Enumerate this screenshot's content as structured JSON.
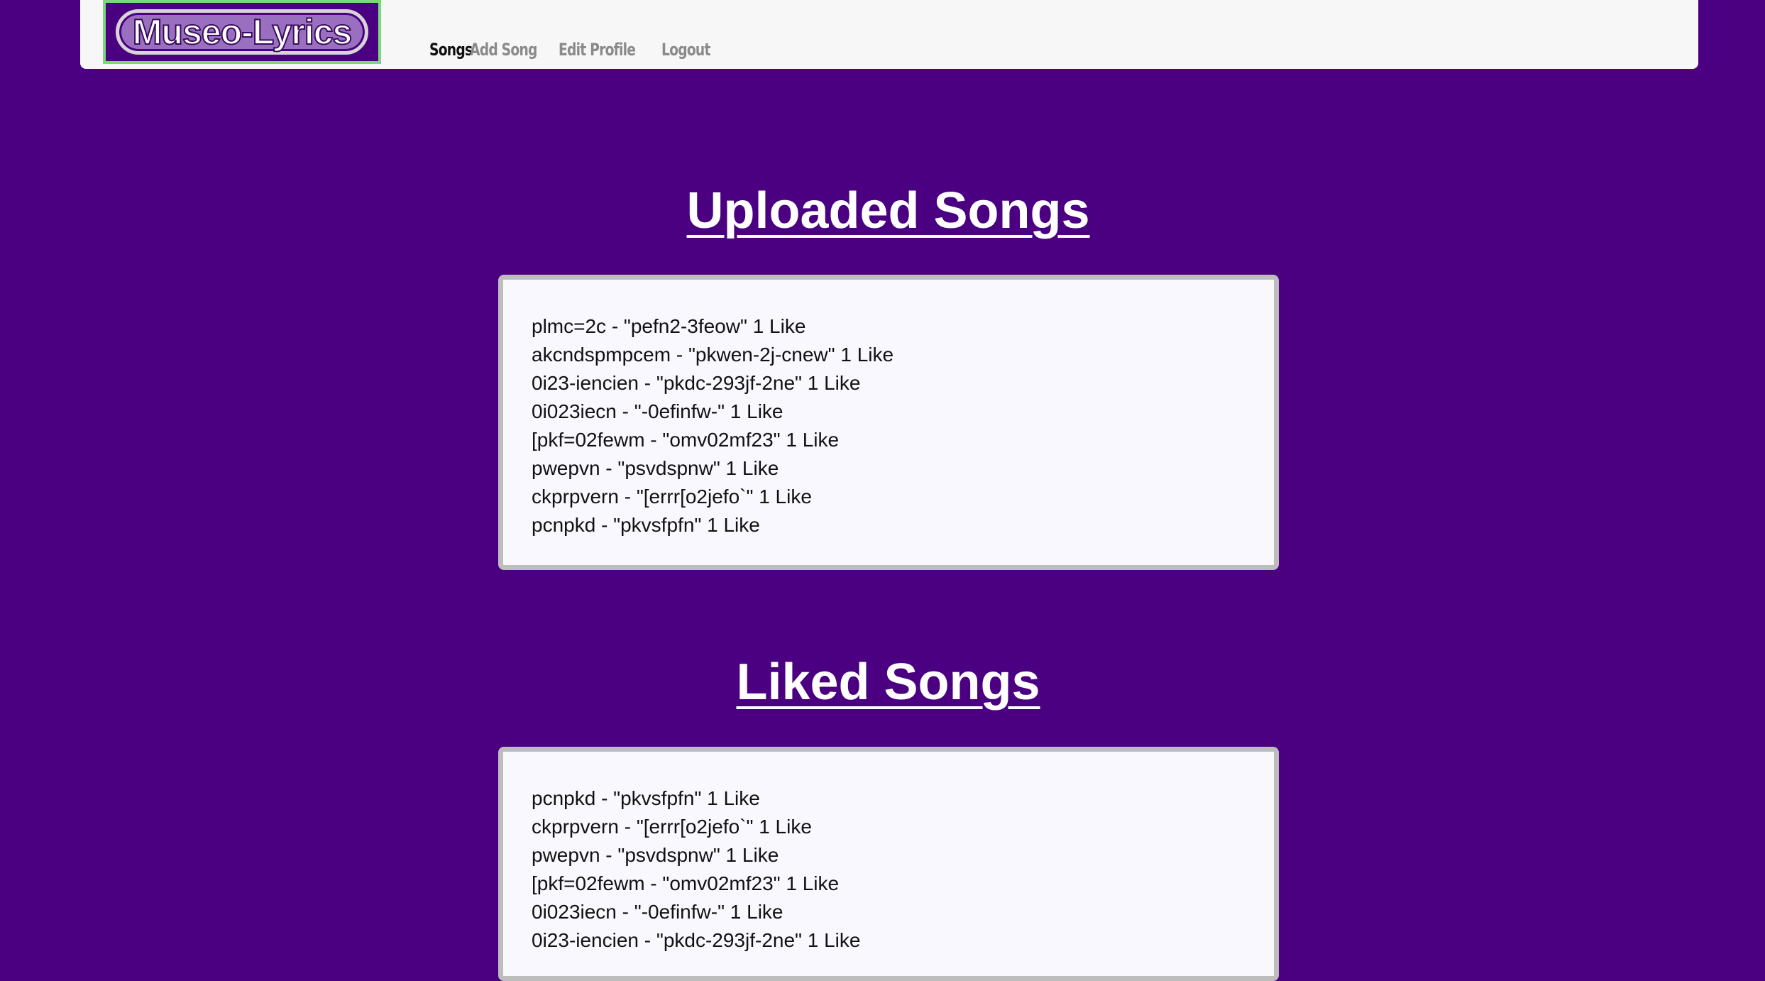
{
  "header": {
    "logo_text": "Museo-Lyrics",
    "nav": [
      {
        "label": "Songs",
        "active": true
      },
      {
        "label": "Add Song",
        "active": false
      },
      {
        "label": "Edit Profile",
        "active": false
      },
      {
        "label": "Logout",
        "active": false
      }
    ]
  },
  "uploaded": {
    "title": "Uploaded Songs",
    "songs": [
      "plmc=2c - \"pefn2-3feow\" 1 Like",
      "akcndspmpcem - \"pkwen-2j-cnew\" 1 Like",
      "0i23-iencien - \"pkdc-293jf-2ne\" 1 Like",
      "0i023iecn - \"-0efinfw-\" 1 Like",
      "[pkf=02fewm - \"omv02mf23\" 1 Like",
      "pwepvn - \"psvdspnw\" 1 Like",
      "ckprpvern - \"[errr[o2jefo`\" 1 Like",
      "pcnpkd - \"pkvsfpfn\" 1 Like"
    ]
  },
  "liked": {
    "title": "Liked Songs",
    "songs": [
      "pcnpkd - \"pkvsfpfn\" 1 Like",
      "ckprpvern - \"[errr[o2jefo`\" 1 Like",
      "pwepvn - \"psvdspnw\" 1 Like",
      "[pkf=02fewm - \"omv02mf23\" 1 Like",
      "0i023iecn - \"-0efinfw-\" 1 Like",
      "0i23-iencien - \"pkdc-293jf-2ne\" 1 Like"
    ]
  },
  "colors": {
    "background": "#4b0082",
    "navbar": "#f7f7f7",
    "logo_border": "#7bd97b",
    "card_background": "#f8f8fe",
    "card_border": "#bdbdbd"
  }
}
